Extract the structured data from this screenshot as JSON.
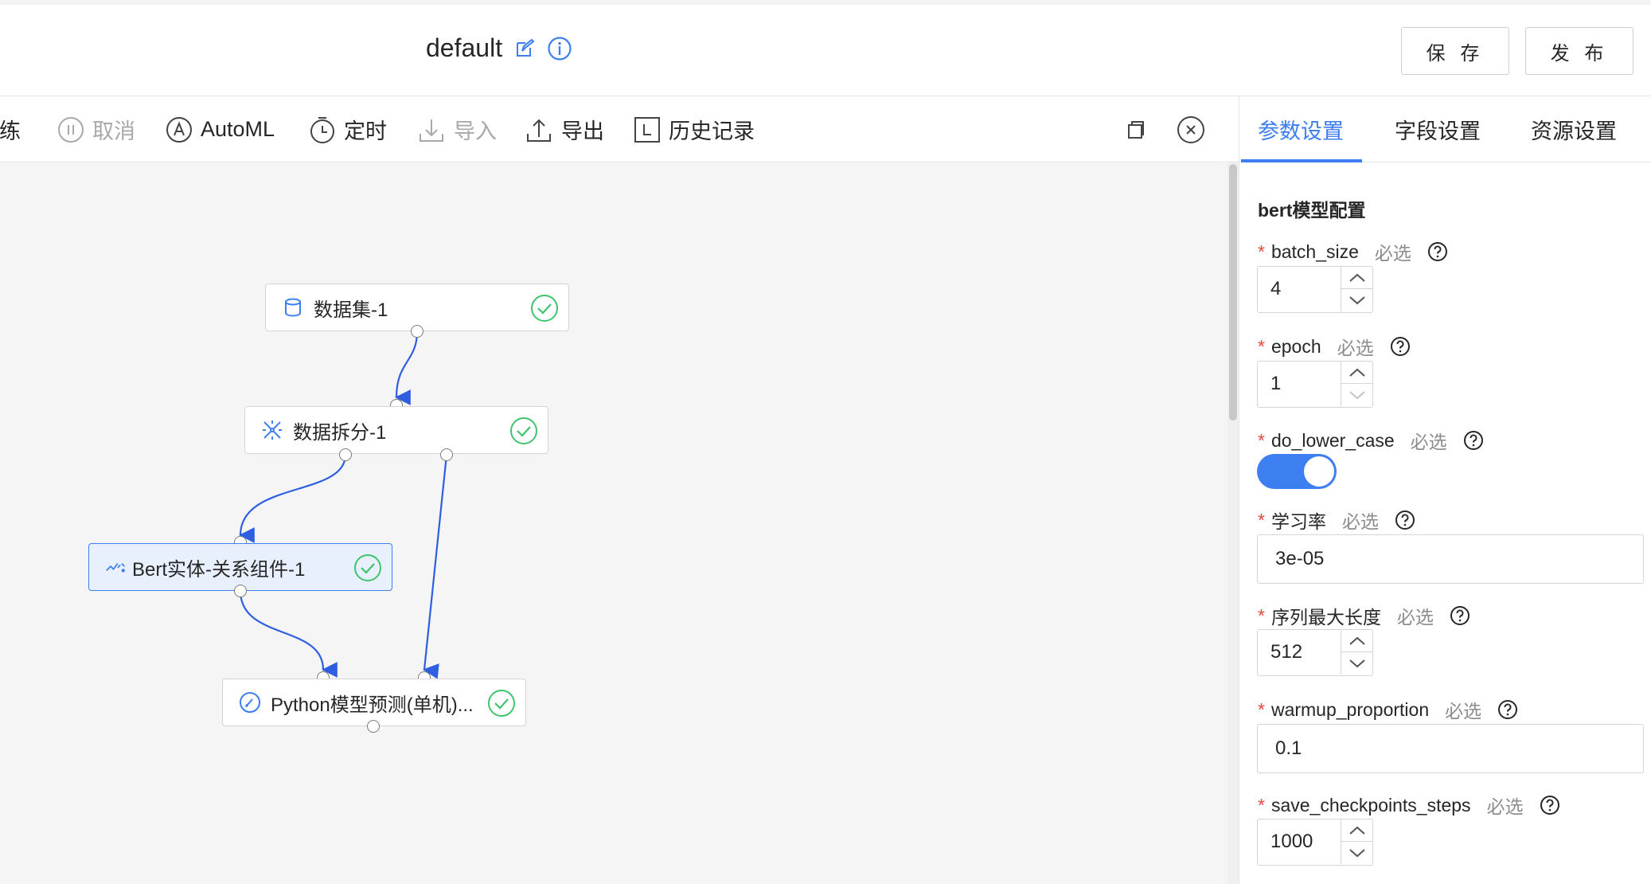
{
  "header": {
    "title": "default",
    "save_label": "保 存",
    "publish_label": "发 布"
  },
  "toolbar": {
    "items": [
      {
        "label": "训练",
        "icon": "train-icon",
        "disabled": false
      },
      {
        "label": "取消",
        "icon": "pause-icon",
        "disabled": true
      },
      {
        "label": "AutoML",
        "icon": "automl-icon",
        "disabled": false
      },
      {
        "label": "定时",
        "icon": "timer-icon",
        "disabled": false
      },
      {
        "label": "导入",
        "icon": "import-icon",
        "disabled": true
      },
      {
        "label": "导出",
        "icon": "export-icon",
        "disabled": false
      },
      {
        "label": "历史记录",
        "icon": "history-icon",
        "disabled": false
      }
    ],
    "right_icons": [
      "copy-icon",
      "close-circle-icon"
    ]
  },
  "canvas": {
    "nodes": [
      {
        "id": "dataset",
        "label": "数据集-1",
        "icon": "database-icon",
        "status": "success"
      },
      {
        "id": "split",
        "label": "数据拆分-1",
        "icon": "split-icon",
        "status": "success"
      },
      {
        "id": "bert",
        "label": "Bert实体-关系组件-1",
        "icon": "model-icon",
        "status": "success",
        "selected": true
      },
      {
        "id": "predict",
        "label": "Python模型预测(单机)...",
        "icon": "gauge-icon",
        "status": "success"
      }
    ]
  },
  "panel": {
    "tabs": [
      {
        "label": "参数设置",
        "active": true
      },
      {
        "label": "字段设置",
        "active": false
      },
      {
        "label": "资源设置",
        "active": false
      }
    ],
    "section_title": "bert模型配置",
    "required_mark": "*",
    "optional_hint": "必选",
    "fields": [
      {
        "name": "batch_size",
        "type": "number",
        "value": "4"
      },
      {
        "name": "epoch",
        "type": "number",
        "value": "1"
      },
      {
        "name": "do_lower_case",
        "type": "switch",
        "value": "on"
      },
      {
        "name": "学习率",
        "type": "text",
        "value": "3e-05"
      },
      {
        "name": "序列最大长度",
        "type": "number",
        "value": "512"
      },
      {
        "name": "warmup_proportion",
        "type": "text",
        "value": "0.1"
      },
      {
        "name": "save_checkpoints_steps",
        "type": "number",
        "value": "1000"
      }
    ]
  },
  "colors": {
    "accent": "#3d7ff0",
    "success": "#3ec46d",
    "required": "#e2483d",
    "link": "#2e5fe0"
  }
}
